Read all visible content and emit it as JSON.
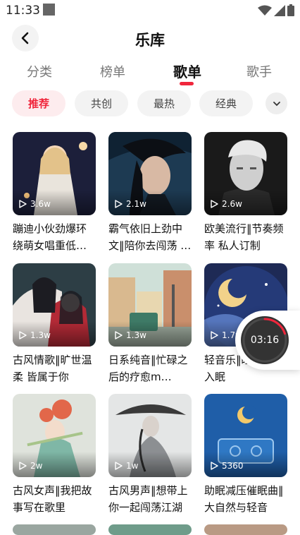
{
  "status_bar": {
    "time": "11:33"
  },
  "header": {
    "title": "乐库"
  },
  "tabs": [
    {
      "label": "分类"
    },
    {
      "label": "榜单"
    },
    {
      "label": "歌单",
      "active": true
    },
    {
      "label": "歌手"
    }
  ],
  "chips": [
    {
      "label": "推荐",
      "active": true
    },
    {
      "label": "共创"
    },
    {
      "label": "最热"
    },
    {
      "label": "经典"
    }
  ],
  "playlists": [
    {
      "plays": "3.6w",
      "title": "蹦迪小伙劲爆环绕萌女唱重低音…"
    },
    {
      "plays": "2.1w",
      "title": "霸气依旧上劲中文‖陪你去闯荡 …"
    },
    {
      "plays": "2.6w",
      "title": "欧美流行‖节奏频率 私人订制"
    },
    {
      "plays": "1.3w",
      "title": "古风情歌‖旷世温柔 皆属于你"
    },
    {
      "plays": "1.3w",
      "title": "日系纯音‖忙碌之后的疗愈m…"
    },
    {
      "plays": "1.7w",
      "title": "轻音乐‖睡着音符入眠"
    },
    {
      "plays": "2w",
      "title": "古风女声‖我把故事写在歌里"
    },
    {
      "plays": "1w",
      "title": "古风男声‖想带上你一起闯荡江湖"
    },
    {
      "plays": "5360",
      "title": "助眠减压催眠曲‖大自然与轻音"
    }
  ],
  "floating_player": {
    "time": "03:16",
    "progress": 0.2
  },
  "colors": {
    "accent": "#f0263c",
    "chip_bg": "#f3f3f3",
    "chip_active_bg": "#fdecee"
  }
}
